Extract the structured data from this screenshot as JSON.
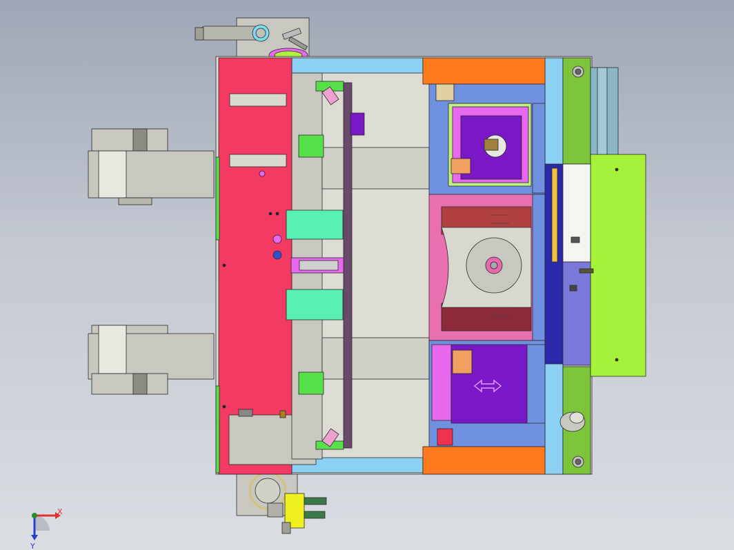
{
  "viewport": {
    "background_top": "#9fa6b5",
    "background_bottom": "#dadde2"
  },
  "triad": {
    "x_label": "X",
    "y_label": "Y",
    "x_color": "#e03030",
    "y_color": "#2c8a2c",
    "z_color": "#2840d0"
  },
  "colors": {
    "frame_red": "#f23a62",
    "frame_orange": "#ff7a1e",
    "lime": "#a6f23a",
    "olive_green": "#7cc43a",
    "violet": "#7a18c8",
    "mint": "#58f0b4",
    "light_blue": "#8cd0f4",
    "magenta": "#e868f0",
    "steel_gray": "#c8c8c0",
    "dark_gray": "#8c8c84",
    "navy": "#2a2aa8"
  }
}
